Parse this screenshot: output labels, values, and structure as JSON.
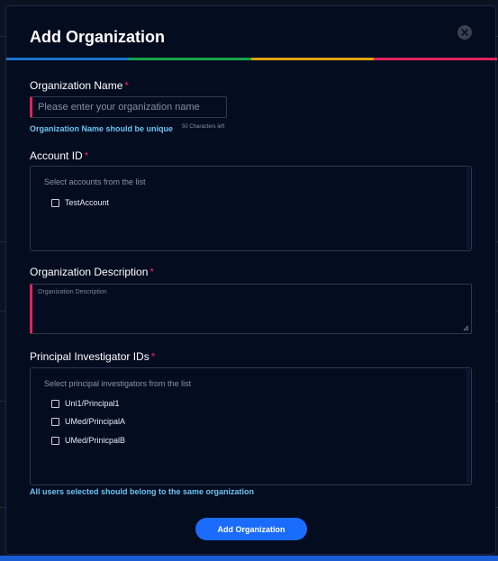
{
  "modal": {
    "title": "Add Organization",
    "close_icon": "close-icon",
    "stripe_colors": [
      "#1b74c9",
      "#16a34a",
      "#e0a10f",
      "#e0245e"
    ]
  },
  "org_name": {
    "label": "Organization Name",
    "required_mark": "*",
    "placeholder": "Please enter your organization name",
    "value": "",
    "hint": "Organization Name should be unique",
    "chars_left": "50 Characters left"
  },
  "account": {
    "label": "Account ID",
    "required_mark": "*",
    "list_hint": "Select accounts from the list",
    "items": [
      {
        "label": "TestAccount",
        "checked": false
      }
    ]
  },
  "description": {
    "label": "Organization Description",
    "required_mark": "*",
    "placeholder": "Organization Description"
  },
  "investigators": {
    "label": "Principal Investigator IDs",
    "required_mark": "*",
    "list_hint": "Select principal investigators from the list",
    "items": [
      {
        "label": "Uni1/Principal1",
        "checked": false
      },
      {
        "label": "UMed/PrincipalA",
        "checked": false
      },
      {
        "label": "UMed/PrinicpalB",
        "checked": false
      }
    ],
    "hint": "All users selected should belong to the same organization"
  },
  "submit_label": "Add Organization",
  "colors": {
    "accent": "#1a6cff",
    "required": "#e0245e",
    "hint": "#6cc3f2",
    "background": "#040c1f"
  }
}
